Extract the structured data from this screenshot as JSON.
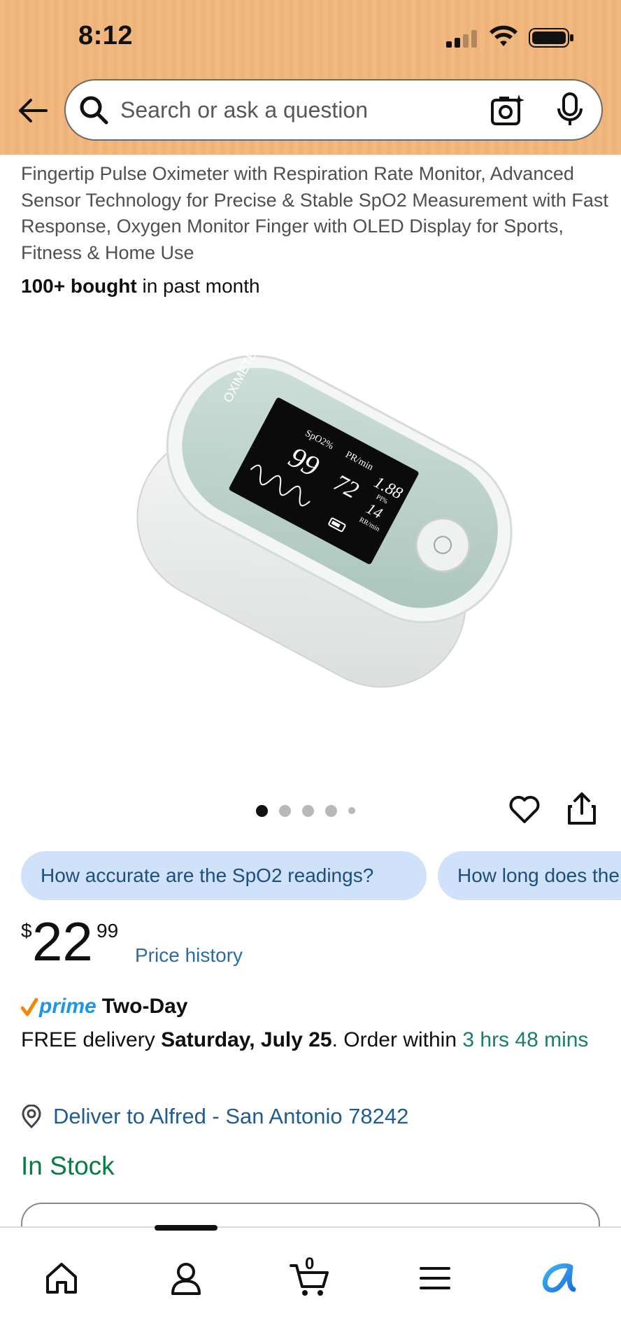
{
  "status_bar": {
    "time": "8:12"
  },
  "search": {
    "placeholder": "Search or ask a question"
  },
  "product": {
    "title": "Fingertip Pulse Oximeter with Respiration Rate Monitor, Advanced Sensor Technology for Precise & Stable SpO2 Measurement with Fast Response, Oxygen Monitor Finger with OLED Display for Sports, Fitness & Home Use",
    "bought_bold": "100+ bought",
    "bought_rest": " in past month",
    "image_label": "OXIMETER",
    "image_readouts": {
      "spo2_label": "SpO2%",
      "pr_label": "PR/min",
      "spo2_value": "99",
      "pr_value": "72",
      "pi_value": "1.88",
      "pi_label": "PI%",
      "rr_value": "14",
      "rr_label": "RR/min"
    },
    "carousel": {
      "total": 5,
      "active_index": 0
    }
  },
  "questions": [
    {
      "label": "How accurate are the SpO2 readings?"
    },
    {
      "label": "How long does the"
    }
  ],
  "price": {
    "currency": "$",
    "whole": "22",
    "fraction": "99",
    "history_link": "Price history"
  },
  "delivery": {
    "prime_label": "prime",
    "two_day_label": "Two-Day",
    "free_text": "FREE delivery ",
    "date": "Saturday, July 25",
    "order_within": ". Order within ",
    "countdown": "3 hrs 48 mins",
    "deliver_to": "Deliver to Alfred - San Antonio 78242"
  },
  "stock": {
    "status": "In Stock"
  },
  "bottom_nav": {
    "cart_count": "0"
  },
  "colors": {
    "header_bg": "#f2b97f",
    "link_blue": "#2e6ba1",
    "stock_green": "#067d45",
    "prime_blue": "#1d96e8",
    "prime_check_orange": "#f08804",
    "chip_bg": "#cfe2f9"
  }
}
